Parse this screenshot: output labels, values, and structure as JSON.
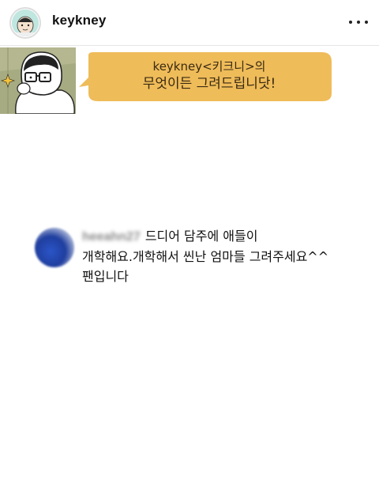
{
  "header": {
    "username": "keykney",
    "more_icon": "more-horizontal-icon"
  },
  "banner": {
    "line1": "keykney<키크니>의",
    "line2": "무엇이든 그려드립니닷!",
    "bubble_color": "#efbc5a",
    "illustration": "glasses-character-drawing"
  },
  "comment": {
    "username": "heeahn27",
    "line1": "드디어 담주에 애들이",
    "line2": "개학해요.개학해서 씬난 엄마들 그려주세요^^",
    "line3": "팬입니다"
  }
}
